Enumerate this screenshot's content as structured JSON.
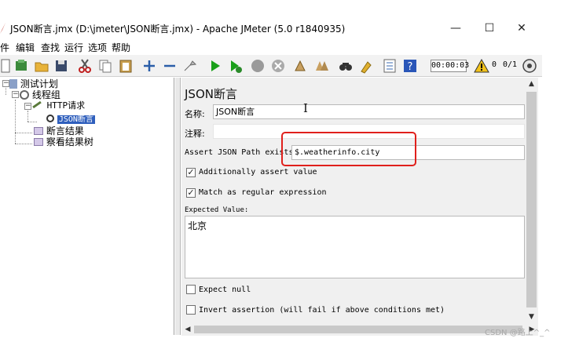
{
  "window": {
    "title": "JSON断言.jmx (D:\\jmeter\\JSON断言.jmx) - Apache JMeter (5.0 r1840935)",
    "minimize": "—",
    "maximize": "☐",
    "close": "✕"
  },
  "menu": [
    "件",
    "编辑",
    "查找",
    "运行",
    "选项",
    "帮助"
  ],
  "toolbar": {
    "timer": "00:00:03",
    "warn_count": "0",
    "threads": "0/1",
    "icons": [
      "new-icon",
      "templates-icon",
      "open-icon",
      "save-icon",
      "cut-icon",
      "copy-icon",
      "paste-icon",
      "expand-icon",
      "collapse-icon",
      "toggle-icon",
      "start-icon",
      "start-no-pause-icon",
      "stop-icon",
      "shutdown-icon",
      "clear-icon",
      "clear-all-icon",
      "search-icon",
      "reset-search-icon",
      "function-helper-icon",
      "help-icon",
      "warning-icon",
      "remote-icon"
    ]
  },
  "tree": {
    "test_plan": "测试计划",
    "thread_group": "线程组",
    "http_request": "HTTP请求",
    "json_assertion": "JSON断言",
    "assertion_results": "断言结果",
    "view_results_tree": "察看结果树"
  },
  "panel": {
    "title": "JSON断言",
    "name_label": "名称:",
    "name_value": "JSON断言",
    "comment_label": "注释:",
    "comment_value": "",
    "assert_path_label": "Assert JSON Path exists:",
    "assert_path_value": "$.weatherinfo.city",
    "additionally_assert": "Additionally assert value",
    "match_regex": "Match as regular expression",
    "expected_label": "Expected Value:",
    "expected_value": "北京",
    "expect_null": "Expect null",
    "invert_assertion": "Invert assertion (will fail if above conditions met)",
    "additionally_checked": "✓",
    "match_checked": "✓"
  },
  "watermark": "CSDN @路上^_^",
  "colors": {
    "selection": "#2f5fbd",
    "highlight_box": "#e0201c",
    "start_green": "#1aa01a"
  }
}
